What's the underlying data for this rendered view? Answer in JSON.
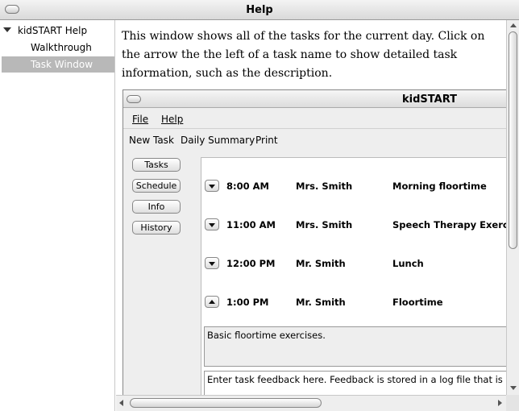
{
  "window": {
    "title": "Help"
  },
  "sidebar": {
    "root_label": "kidSTART Help",
    "items": [
      {
        "label": "Walkthrough",
        "selected": false
      },
      {
        "label": "Task Window",
        "selected": true
      }
    ]
  },
  "content": {
    "intro": "This window shows all of the tasks for the current day. Click on the arrow the the left of a task name to show detailed task information, such as the description."
  },
  "app_window": {
    "title": "kidSTART",
    "menu": {
      "file": "File",
      "help": "Help"
    },
    "toolbar": {
      "new_task": "New Task",
      "daily_summary": "Daily Summary",
      "print": "Print"
    },
    "nav_buttons": [
      "Tasks",
      "Schedule",
      "Info",
      "History"
    ],
    "tasks": [
      {
        "time": "8:00 AM",
        "person": "Mrs. Smith",
        "name": "Morning floortime",
        "expanded": false
      },
      {
        "time": "11:00 AM",
        "person": "Mrs. Smith",
        "name": "Speech Therapy Exercis",
        "expanded": false
      },
      {
        "time": "12:00 PM",
        "person": "Mr. Smith",
        "name": "Lunch",
        "expanded": false
      },
      {
        "time": "1:00 PM",
        "person": "Mr. Smith",
        "name": "Floortime",
        "expanded": true
      }
    ],
    "description": "Basic floortime exercises.",
    "feedback": "Enter task feedback here.  Feedback is stored in a log file that is adde"
  }
}
